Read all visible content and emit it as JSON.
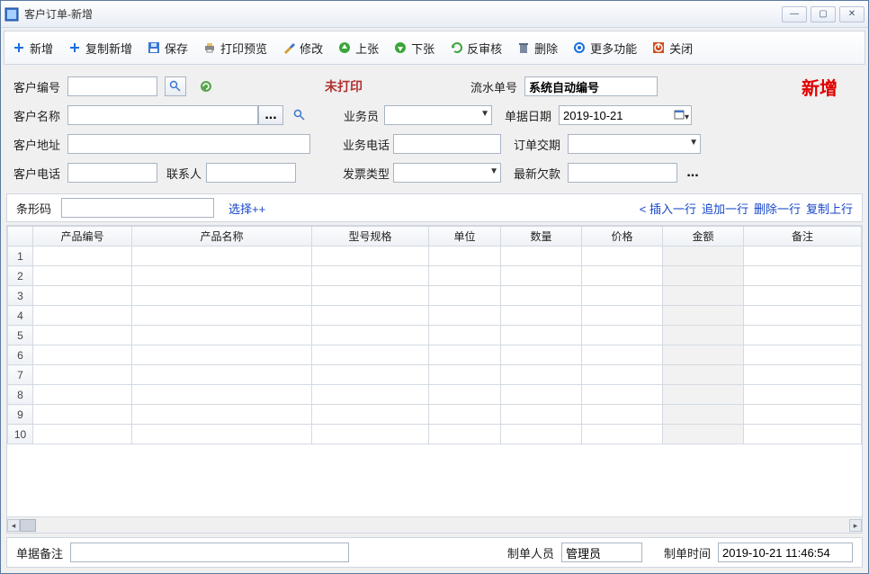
{
  "window": {
    "title": "客户订单-新增"
  },
  "toolbar": {
    "new": "新增",
    "copyNew": "复制新增",
    "save": "保存",
    "printPreview": "打印预览",
    "modify": "修改",
    "prev": "上张",
    "next": "下张",
    "unapprove": "反审核",
    "delete": "删除",
    "more": "更多功能",
    "close": "关闭"
  },
  "form": {
    "customerCode": {
      "label": "客户编号",
      "value": ""
    },
    "customerName": {
      "label": "客户名称",
      "value": ""
    },
    "customerAddr": {
      "label": "客户地址",
      "value": ""
    },
    "customerPhone": {
      "label": "客户电话",
      "value": ""
    },
    "contact": {
      "label": "联系人",
      "value": ""
    },
    "unprinted": "未打印",
    "salesman": {
      "label": "业务员",
      "value": ""
    },
    "bizPhone": {
      "label": "业务电话",
      "value": ""
    },
    "invoiceType": {
      "label": "发票类型",
      "value": ""
    },
    "serialNo": {
      "label": "流水单号",
      "value": "系统自动编号"
    },
    "billDate": {
      "label": "单据日期",
      "value": "2019-10-21"
    },
    "deliveryDate": {
      "label": "订单交期",
      "value": ""
    },
    "latestArrears": {
      "label": "最新欠款",
      "value": ""
    },
    "statusNew": "新增"
  },
  "barcode": {
    "label": "条形码",
    "value": "",
    "selectBtn": "选择++"
  },
  "rowActions": {
    "insert": "< 插入一行",
    "append": "追加一行",
    "delete": "删除一行",
    "copy": "复制上行"
  },
  "grid": {
    "headers": [
      "产品编号",
      "产品名称",
      "型号规格",
      "单位",
      "数量",
      "价格",
      "金额",
      "备注"
    ],
    "rowCount": 10
  },
  "footer": {
    "remarkLabel": "单据备注",
    "remarkValue": "",
    "makerLabel": "制单人员",
    "makerValue": "管理员",
    "makeTimeLabel": "制单时间",
    "makeTimeValue": "2019-10-21 11:46:54"
  }
}
